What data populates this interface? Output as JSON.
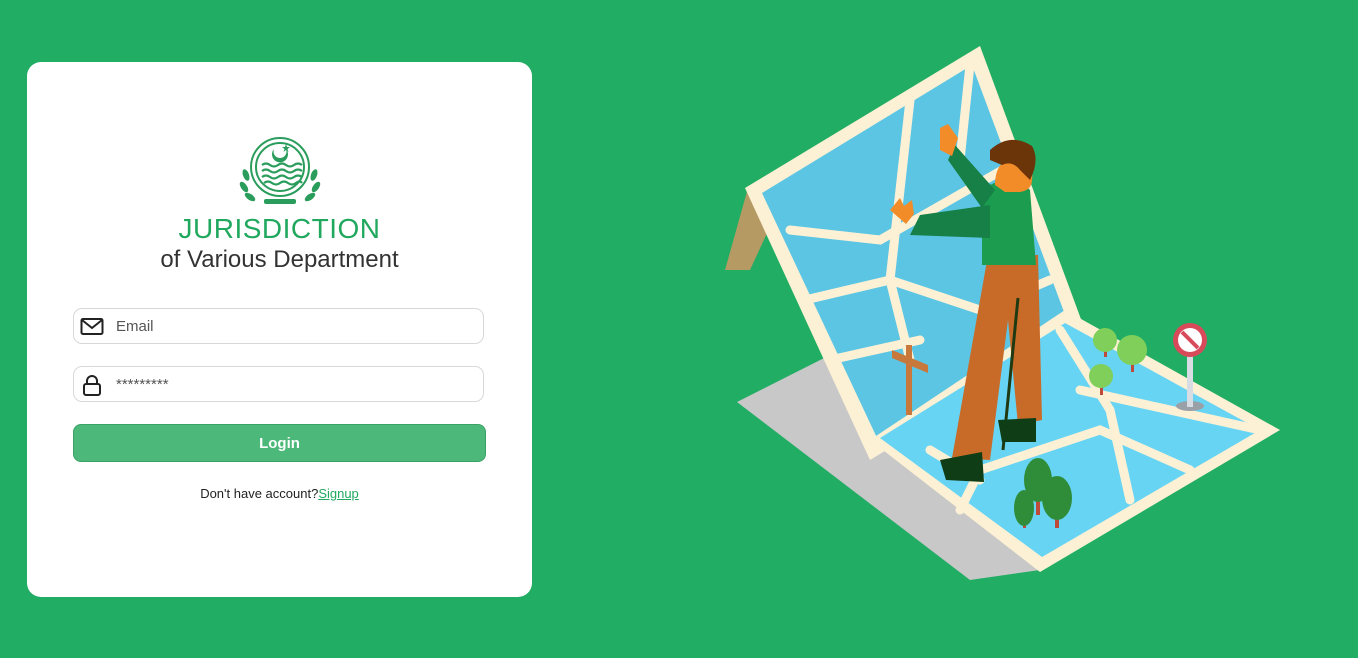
{
  "app": {
    "title": "JURISDICTION",
    "subtitle": "of Various Department"
  },
  "form": {
    "email_placeholder": "Email",
    "password_value": "*********",
    "login_label": "Login",
    "signup_prompt": "Don't have account?",
    "signup_link": "Signup"
  },
  "icons": {
    "logo": "punjab-government-emblem",
    "email": "envelope-icon",
    "password": "lock-icon"
  },
  "colors": {
    "background": "#21ad64",
    "brand": "#21a85f",
    "button": "#4cb87a"
  }
}
